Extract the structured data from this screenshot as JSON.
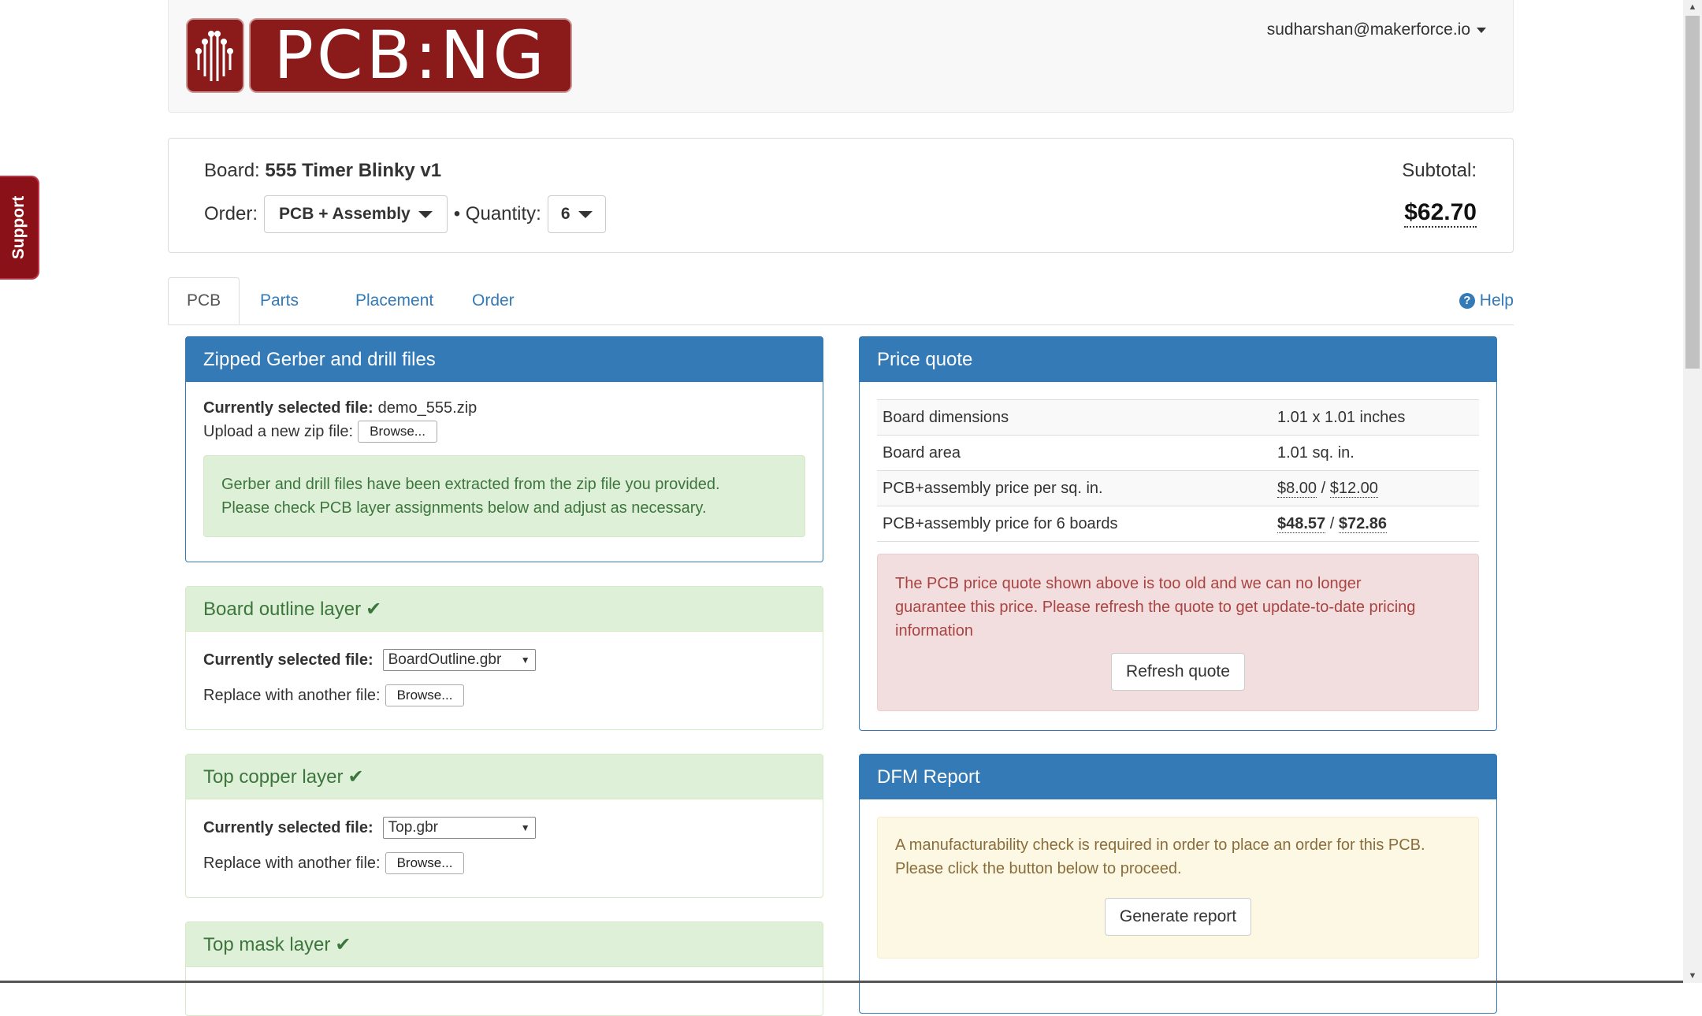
{
  "support": {
    "label": "Support"
  },
  "header": {
    "logo_text": "PCB:NG",
    "user_email": "sudharshan@makerforce.io"
  },
  "board": {
    "board_label": "Board:",
    "board_name": "555 Timer Blinky v1",
    "order_label": "Order:",
    "order_value": "PCB + Assembly",
    "quantity_label": "• Quantity:",
    "quantity_value": "6",
    "subtotal_label": "Subtotal:",
    "subtotal_value": "$62.70"
  },
  "tabs": [
    {
      "label": "PCB",
      "active": true
    },
    {
      "label": "Parts"
    },
    {
      "label": "Placement"
    },
    {
      "label": "Order"
    }
  ],
  "help_label": "Help",
  "gerber": {
    "title": "Zipped Gerber and drill files",
    "selected_label": "Currently selected file:",
    "selected_value": "demo_555.zip",
    "upload_label": "Upload a new zip file:",
    "browse_label": "Browse...",
    "alert_line1": "Gerber and drill files have been extracted from the zip file you provided.",
    "alert_line2": "Please check PCB layer assignments below and adjust as necessary."
  },
  "layers": [
    {
      "title": "Board outline layer",
      "selected_label": "Currently selected file:",
      "selected_value": "BoardOutline.gbr",
      "replace_label": "Replace with another file:",
      "browse_label": "Browse..."
    },
    {
      "title": "Top copper layer",
      "selected_label": "Currently selected file:",
      "selected_value": "Top.gbr",
      "replace_label": "Replace with another file:",
      "browse_label": "Browse..."
    },
    {
      "title": "Top mask layer"
    }
  ],
  "quote": {
    "title": "Price quote",
    "rows": [
      {
        "label": "Board dimensions",
        "value": "1.01 x 1.01 inches"
      },
      {
        "label": "Board area",
        "value": "1.01 sq. in."
      },
      {
        "label": "PCB+assembly price per sq. in.",
        "value_a": "$8.00",
        "sep": " / ",
        "value_b": "$12.00"
      },
      {
        "label": "PCB+assembly price for 6 boards",
        "value_a": "$48.57",
        "sep": " / ",
        "value_b": "$72.86"
      }
    ],
    "alert_line1": "The PCB price quote shown above is too old and we can no longer",
    "alert_line2": "guarantee this price. Please refresh the quote to get update-to-date pricing",
    "alert_line3": "information",
    "refresh_label": "Refresh quote"
  },
  "dfm": {
    "title": "DFM Report",
    "alert_line1": "A manufacturability check is required in order to place an order for this PCB.",
    "alert_line2": "Please click the button below to proceed.",
    "generate_label": "Generate report"
  },
  "icons": {
    "check": "✔",
    "help": "?"
  },
  "colors": {
    "brand": "#8b1a1a",
    "primary": "#337ab7",
    "success_bg": "#dff0d8",
    "danger_bg": "#f2dede",
    "warning_bg": "#fcf8e3"
  }
}
